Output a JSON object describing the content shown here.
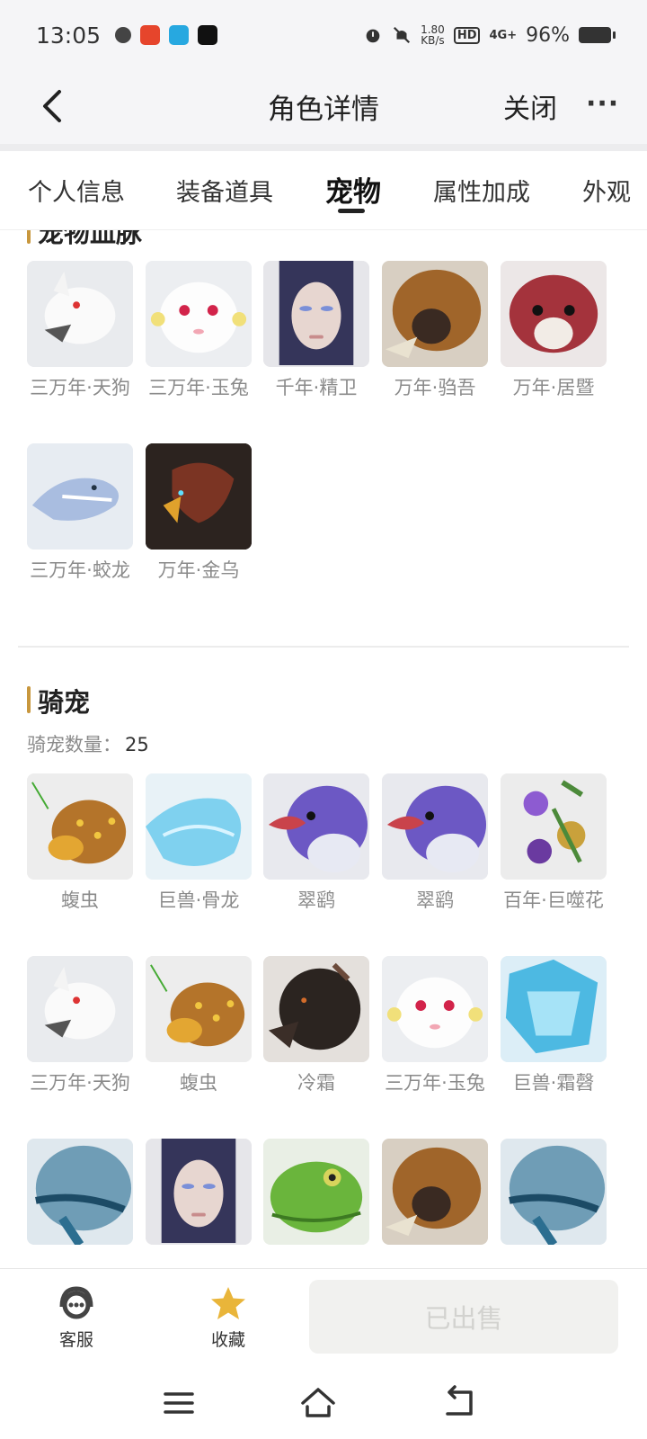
{
  "status_bar": {
    "time": "13:05",
    "speed_top": "1.80",
    "speed_bottom": "KB/s",
    "hd": "HD",
    "network": "4G+",
    "battery": "96%"
  },
  "header": {
    "title": "角色详情",
    "close_label": "关闭",
    "more_label": "···"
  },
  "tabs": [
    {
      "label": "个人信息"
    },
    {
      "label": "装备道具"
    },
    {
      "label": "宠物"
    },
    {
      "label": "属性加成"
    },
    {
      "label": "外观"
    }
  ],
  "sections": {
    "pet_bloodline": {
      "title": "宠物血脉",
      "items": [
        {
          "name": "三万年·天狗",
          "icon": "white-wolf-icon"
        },
        {
          "name": "三万年·玉兔",
          "icon": "white-rabbit-icon"
        },
        {
          "name": "千年·精卫",
          "icon": "woman-face-icon"
        },
        {
          "name": "万年·驺吾",
          "icon": "lion-beast-icon"
        },
        {
          "name": "万年·居暨",
          "icon": "red-squirrel-icon"
        },
        {
          "name": "三万年·蛟龙",
          "icon": "ice-dragon-icon"
        },
        {
          "name": "万年·金乌",
          "icon": "fire-bird-icon"
        }
      ]
    },
    "mounts": {
      "title": "骑宠",
      "count_label": "骑宠数量：",
      "count_value": "25",
      "items": [
        {
          "name": "蝮虫",
          "icon": "leopard-insect-icon"
        },
        {
          "name": "巨兽·骨龙",
          "icon": "blue-bone-dragon-icon"
        },
        {
          "name": "翠鹞",
          "icon": "purple-bird-icon"
        },
        {
          "name": "翠鹞",
          "icon": "purple-bird-icon"
        },
        {
          "name": "百年·巨噬花",
          "icon": "flower-icon"
        },
        {
          "name": "三万年·天狗",
          "icon": "white-wolf-icon"
        },
        {
          "name": "蝮虫",
          "icon": "leopard-insect-icon"
        },
        {
          "name": "冷霜",
          "icon": "black-wolf-icon"
        },
        {
          "name": "三万年·玉兔",
          "icon": "white-rabbit-icon"
        },
        {
          "name": "巨兽·霜㲈",
          "icon": "ice-crystal-beast-icon"
        },
        {
          "name": "",
          "icon": "armored-beast-icon"
        },
        {
          "name": "",
          "icon": "woman-face-icon"
        },
        {
          "name": "",
          "icon": "green-frog-icon"
        },
        {
          "name": "",
          "icon": "lion-beast-icon"
        },
        {
          "name": "",
          "icon": "armored-beast-icon"
        }
      ]
    }
  },
  "bottom_bar": {
    "service_label": "客服",
    "favorite_label": "收藏",
    "sold_label": "已出售"
  },
  "colors": {
    "accent": "#c8973d",
    "star": "#e9b53a"
  }
}
